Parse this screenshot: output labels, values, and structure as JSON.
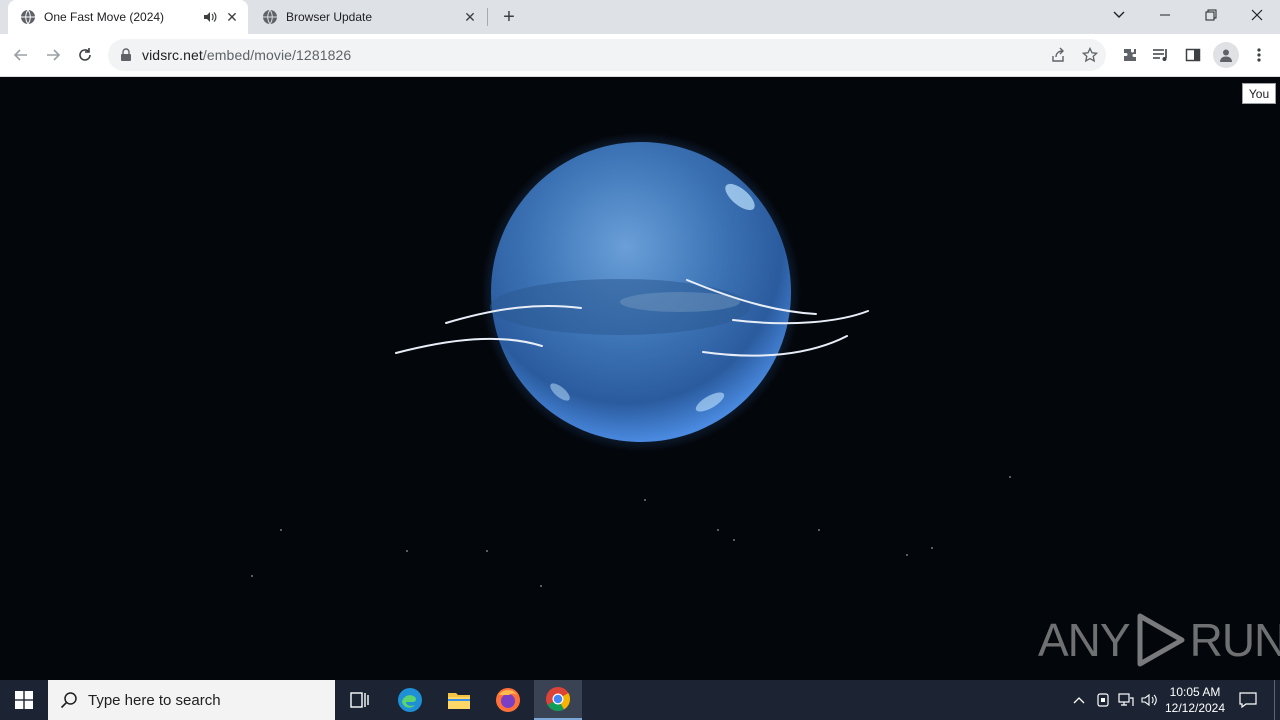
{
  "browser": {
    "tabs": [
      {
        "title": "One Fast Move (2024)",
        "active": true,
        "audio": true
      },
      {
        "title": "Browser Update",
        "active": false
      }
    ],
    "url": {
      "host": "vidsrc.net",
      "path": "/embed/movie/1281826"
    },
    "profile_tooltip": "You"
  },
  "content": {
    "watermark_left": "ANY",
    "watermark_right": "RUN"
  },
  "taskbar": {
    "search_placeholder": "Type here to search",
    "time": "10:05 AM",
    "date": "12/12/2024"
  },
  "colors": {
    "tabstrip": "#dee1e6",
    "content_bg": "#03060b",
    "planet": "#3a78c6",
    "taskbar": "#1c2433"
  }
}
